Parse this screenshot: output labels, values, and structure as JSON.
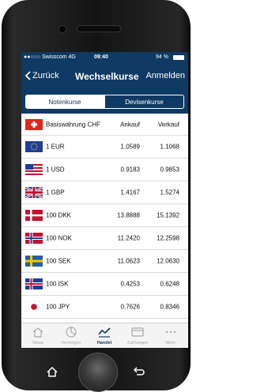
{
  "status": {
    "carrier": "●●○○○ Swisscom  4G",
    "time": "09:40",
    "battery": "94 %"
  },
  "nav": {
    "back_label": "Zurück",
    "title": "Wechselkurse",
    "login_label": "Anmelden"
  },
  "segments": {
    "active": "Notenkurse",
    "inactive": "Devisenkurse"
  },
  "table": {
    "header": {
      "base": "Basiswährung CHF",
      "buy": "Ankauf",
      "sell": "Verkauf"
    },
    "rows": [
      {
        "currency": "1 EUR",
        "buy": "1.0589",
        "sell": "1.1068",
        "flag": "eu-flag-icon"
      },
      {
        "currency": "1 USD",
        "buy": "0.9183",
        "sell": "0.9853",
        "flag": "us-flag-icon"
      },
      {
        "currency": "1 GBP",
        "buy": "1.4167",
        "sell": "1.5274",
        "flag": "uk-flag-icon"
      },
      {
        "currency": "100 DKK",
        "buy": "13.8888",
        "sell": "15.1392",
        "flag": "dk-flag-icon"
      },
      {
        "currency": "100 NOK",
        "buy": "11.2420",
        "sell": "12.2598",
        "flag": "no-flag-icon"
      },
      {
        "currency": "100 SEK",
        "buy": "11.0623",
        "sell": "12.0630",
        "flag": "se-flag-icon"
      },
      {
        "currency": "100 ISK",
        "buy": "0.4253",
        "sell": "0.6248",
        "flag": "is-flag-icon"
      },
      {
        "currency": "100 JPY",
        "buy": "0.7626",
        "sell": "0.8346",
        "flag": "jp-flag-icon"
      }
    ]
  },
  "tabs": [
    {
      "label": "News",
      "icon": "house-icon"
    },
    {
      "label": "Vermögen",
      "icon": "pie-chart-icon"
    },
    {
      "label": "Handel",
      "icon": "line-chart-icon"
    },
    {
      "label": "Zahlungen",
      "icon": "card-icon"
    },
    {
      "label": "Mehr",
      "icon": "more-dots-icon"
    }
  ],
  "colors": {
    "primary": "#0f3a63",
    "tab_inactive": "#a8a8a8"
  }
}
